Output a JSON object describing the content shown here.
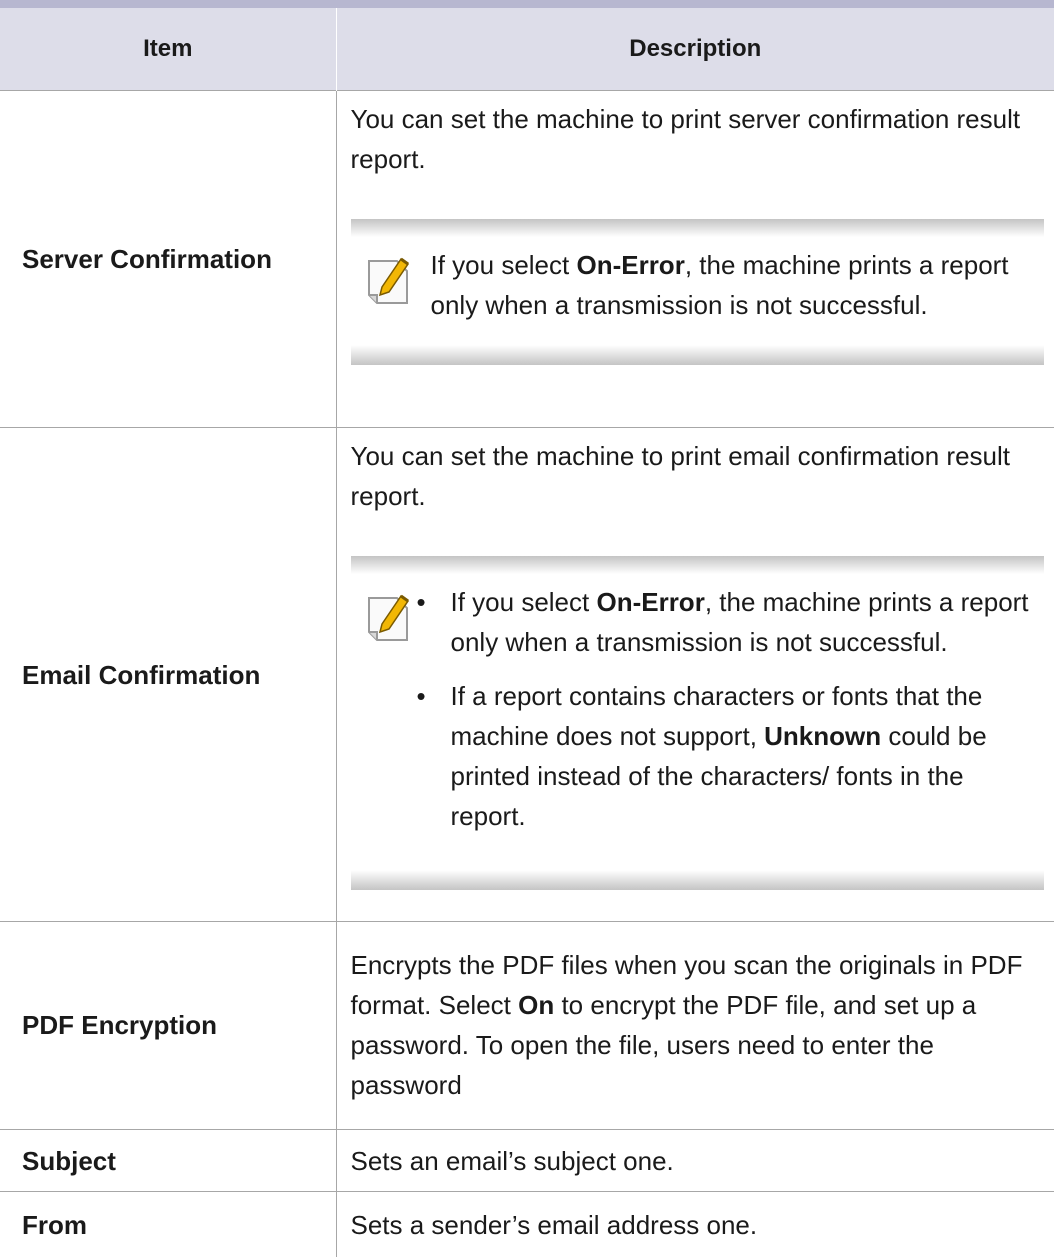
{
  "table": {
    "headers": {
      "item": "Item",
      "description": "Description"
    },
    "server_confirmation": {
      "item": "Server Confirmation",
      "description": "You can set the machine to print server confirmation result report.",
      "note": {
        "pre": "If you select ",
        "bold": "On-Error",
        "post": ", the machine prints a report only when a transmission is not successful."
      }
    },
    "email_confirmation": {
      "item": "Email Confirmation",
      "description": "You can set the machine to print email confirmation result report.",
      "bullet_glyph": "•",
      "note_items": [
        {
          "pre": "If you select ",
          "bold": "On-Error",
          "post": ", the machine prints a report only when a transmission is not successful."
        },
        {
          "pre": "If a report contains characters or fonts that the machine does not support, ",
          "bold": "Unknown",
          "post": " could be printed instead of the characters/ fonts in the report."
        }
      ]
    },
    "pdf_encryption": {
      "item": "PDF Encryption",
      "pre": "Encrypts the PDF files when you scan the originals in PDF format. Select ",
      "bold": "On",
      "post": " to encrypt the PDF file, and set up a password. To open the file, users need to enter the password"
    },
    "subject": {
      "item": "Subject",
      "description": "Sets an email’s subject one."
    },
    "from": {
      "item": "From",
      "description": "Sets a sender’s email address one."
    }
  },
  "colors": {
    "header_bg": "#dddde9",
    "header_rule": "#b7b7d0",
    "grid_line": "#a7a7a7",
    "note_icon_accent": "#f2b705"
  },
  "icons": {
    "note": "note-pencil-icon"
  }
}
